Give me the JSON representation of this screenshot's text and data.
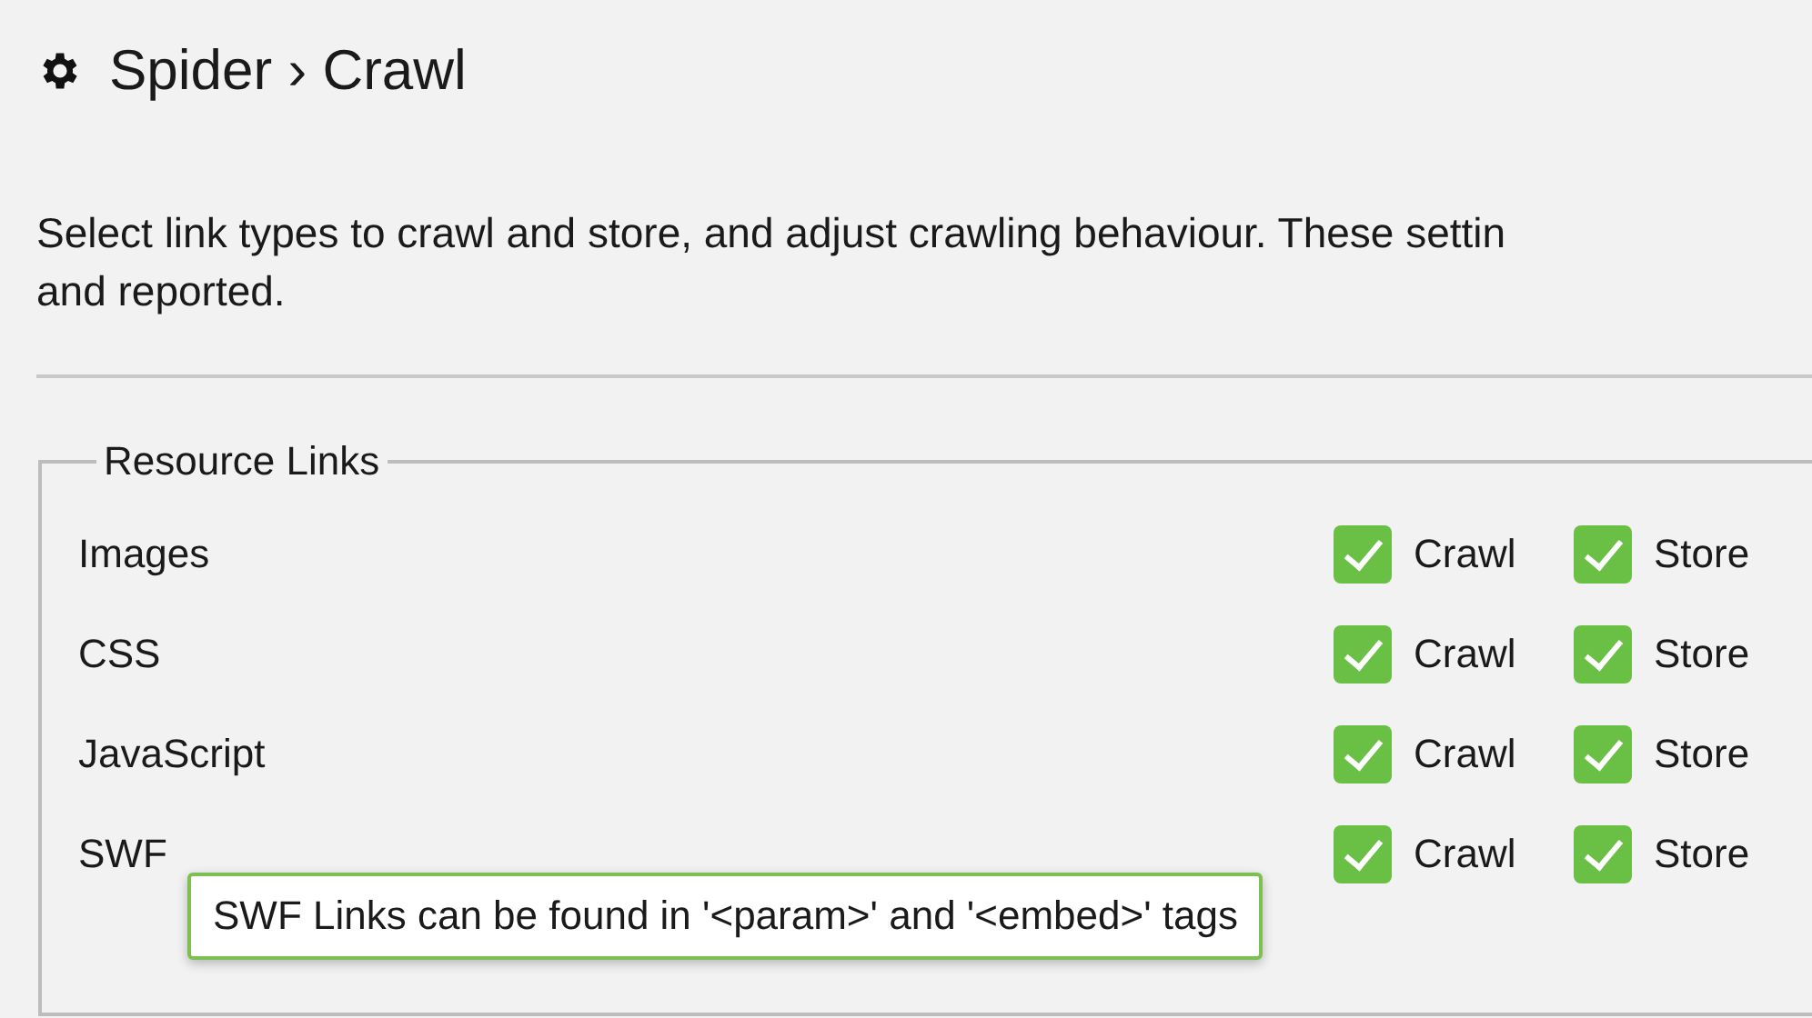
{
  "header": {
    "section": "Spider",
    "separator": "›",
    "page": "Crawl"
  },
  "description": [
    "Select link types to crawl and store, and adjust crawling behaviour. These settin",
    "and reported."
  ],
  "group": {
    "legend": "Resource Links",
    "rows": [
      {
        "label": "Images",
        "options": [
          {
            "label": "Crawl",
            "checked": true
          },
          {
            "label": "Store",
            "checked": true
          }
        ]
      },
      {
        "label": "CSS",
        "options": [
          {
            "label": "Crawl",
            "checked": true
          },
          {
            "label": "Store",
            "checked": true
          }
        ]
      },
      {
        "label": "JavaScript",
        "options": [
          {
            "label": "Crawl",
            "checked": true
          },
          {
            "label": "Store",
            "checked": true
          }
        ]
      },
      {
        "label": "SWF",
        "options": [
          {
            "label": "Crawl",
            "checked": true
          },
          {
            "label": "Store",
            "checked": true
          }
        ]
      }
    ]
  },
  "tooltip": {
    "text": "SWF Links can be found in '<param>' and '<embed>' tags"
  }
}
